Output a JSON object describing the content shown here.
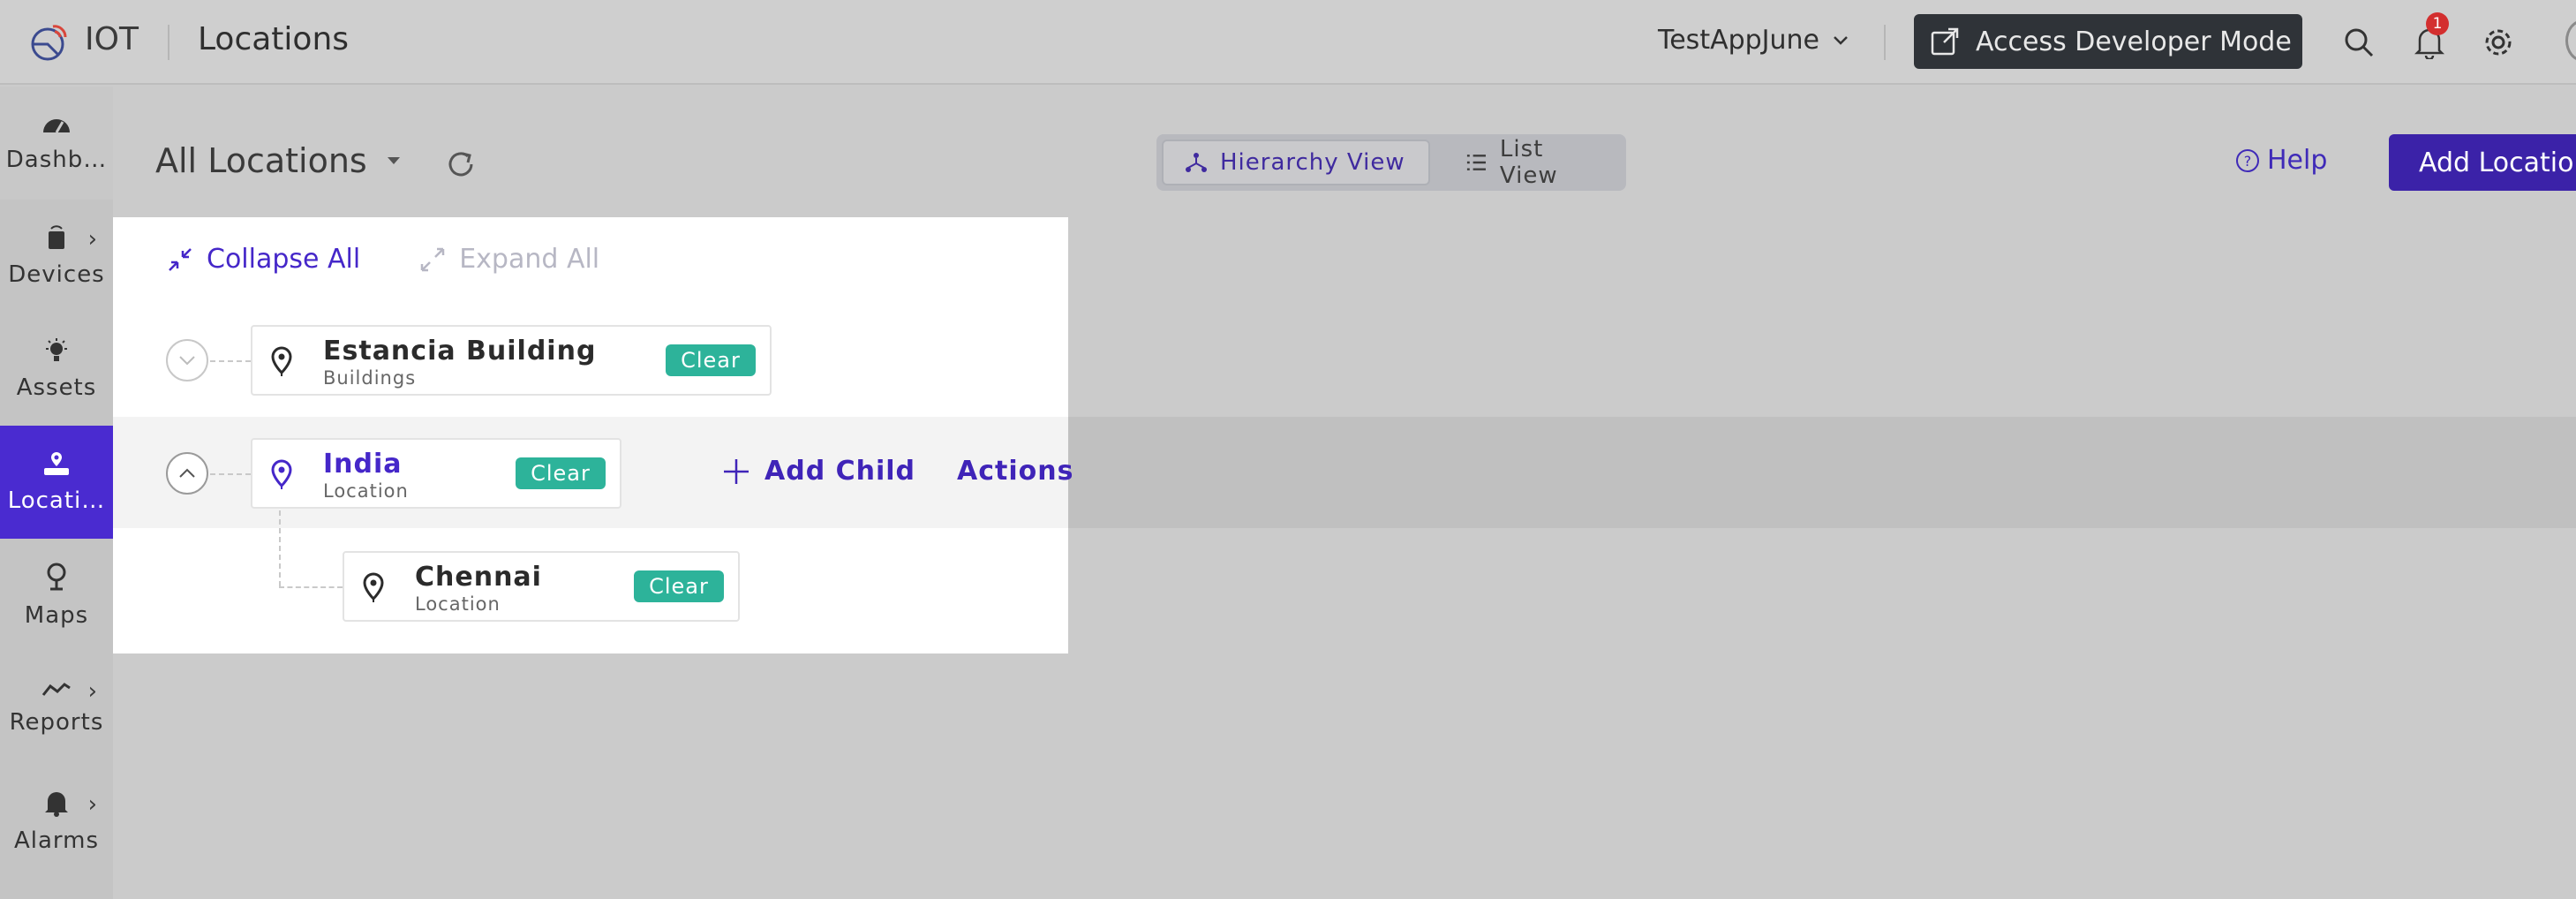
{
  "topbar": {
    "app_name": "IOT",
    "page_name": "Locations",
    "app_selector": "TestAppJune",
    "developer_button": "Access Developer Mode",
    "notification_count": "1"
  },
  "sidebar": {
    "items": [
      {
        "label": "Dashb…",
        "icon": "dashboard-icon"
      },
      {
        "label": "Devices",
        "icon": "device-icon"
      },
      {
        "label": "Assets",
        "icon": "asset-icon"
      },
      {
        "label": "Locati…",
        "icon": "location-icon"
      },
      {
        "label": "Maps",
        "icon": "map-pin-icon"
      },
      {
        "label": "Reports",
        "icon": "reports-icon"
      },
      {
        "label": "Alarms",
        "icon": "bell-icon"
      }
    ]
  },
  "header": {
    "title": "All Locations",
    "hierarchy_view": "Hierarchy View",
    "list_view": "List View",
    "help": "Help",
    "add_button": "Add Location"
  },
  "tree": {
    "collapse_all": "Collapse All",
    "expand_all": "Expand All",
    "nodes": [
      {
        "name": "Estancia Building",
        "type": "Buildings",
        "badge": "Clear"
      },
      {
        "name": "India",
        "type": "Location",
        "badge": "Clear"
      },
      {
        "name": "Chennai",
        "type": "Location",
        "badge": "Clear"
      }
    ],
    "add_child": "Add Child",
    "actions": "Actions"
  },
  "colors": {
    "accent": "#4527c9",
    "active_nav": "#4a2bd0",
    "badge_clear": "#2db39a",
    "dev_button": "#2f3338"
  }
}
